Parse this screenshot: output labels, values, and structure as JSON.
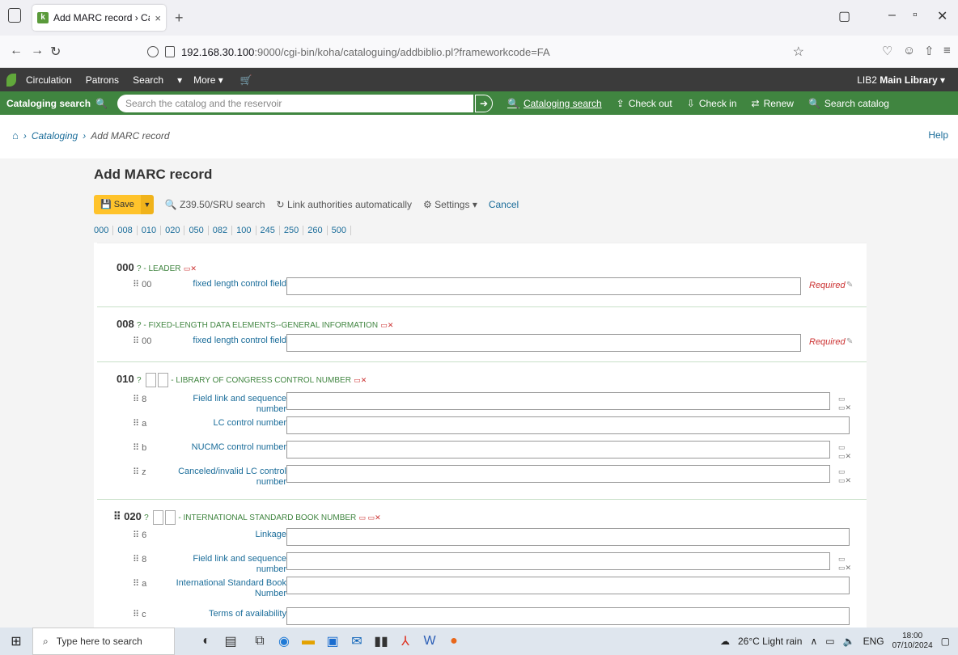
{
  "browser": {
    "tab_title": "Add MARC record › Cataloging",
    "tab_close": "×",
    "new_tab": "+",
    "url_host": "192.168.30.100",
    "url_rest": ":9000/cgi-bin/koha/cataloguing/addbiblio.pl?frameworkcode=FA"
  },
  "header": {
    "nav": [
      "Circulation",
      "Patrons",
      "Search",
      "▾",
      "More ▾"
    ],
    "library_code": "LIB2",
    "library_name": "Main Library",
    "library_caret": "▾"
  },
  "searchbar": {
    "label": "Cataloging search",
    "placeholder": "Search the catalog and the reservoir",
    "links": [
      "Cataloging search",
      "Check out",
      "Check in",
      "Renew",
      "Search catalog"
    ]
  },
  "breadcrumb": {
    "items": [
      "Cataloging",
      "Add MARC record"
    ],
    "help": "Help"
  },
  "page": {
    "title": "Add MARC record",
    "save": "Save",
    "z3950": "Z39.50/SRU search",
    "link_auth": "Link authorities automatically",
    "settings": "Settings ▾",
    "cancel": "Cancel",
    "tag_nav": [
      "000",
      "008",
      "010",
      "020",
      "050",
      "082",
      "100",
      "245",
      "250",
      "260",
      "500"
    ]
  },
  "tags": [
    {
      "num": "000",
      "name": "? - LEADER",
      "subs": [
        {
          "code": "⠿ 00",
          "label": "fixed length control field",
          "required": "Required"
        }
      ]
    },
    {
      "num": "008",
      "name": "? - FIXED-LENGTH DATA ELEMENTS--GENERAL INFORMATION",
      "subs": [
        {
          "code": "⠿ 00",
          "label": "fixed length control field",
          "required": "Required"
        }
      ]
    },
    {
      "num": "010",
      "q": "?",
      "name": "- LIBRARY OF CONGRESS CONTROL NUMBER",
      "subs": [
        {
          "code": "⠿ 8",
          "label": "Field link and sequence number"
        },
        {
          "code": "⠿ a",
          "label": "LC control number"
        },
        {
          "code": "⠿ b",
          "label": "NUCMC control number"
        },
        {
          "code": "⠿ z",
          "label": "Canceled/invalid LC control number"
        }
      ]
    },
    {
      "num": "⠿ 020",
      "q": "?",
      "name": "- INTERNATIONAL STANDARD BOOK NUMBER",
      "subs": [
        {
          "code": "⠿ 6",
          "label": "Linkage"
        },
        {
          "code": "⠿ 8",
          "label": "Field link and sequence number"
        },
        {
          "code": "⠿ a",
          "label": "International Standard Book Number"
        },
        {
          "code": "⠿ c",
          "label": "Terms of availability"
        }
      ]
    }
  ],
  "taskbar": {
    "search": "Type here to search",
    "weather": "26°C  Light rain",
    "lang": "ENG",
    "time": "18:00",
    "date": "07/10/2024"
  }
}
